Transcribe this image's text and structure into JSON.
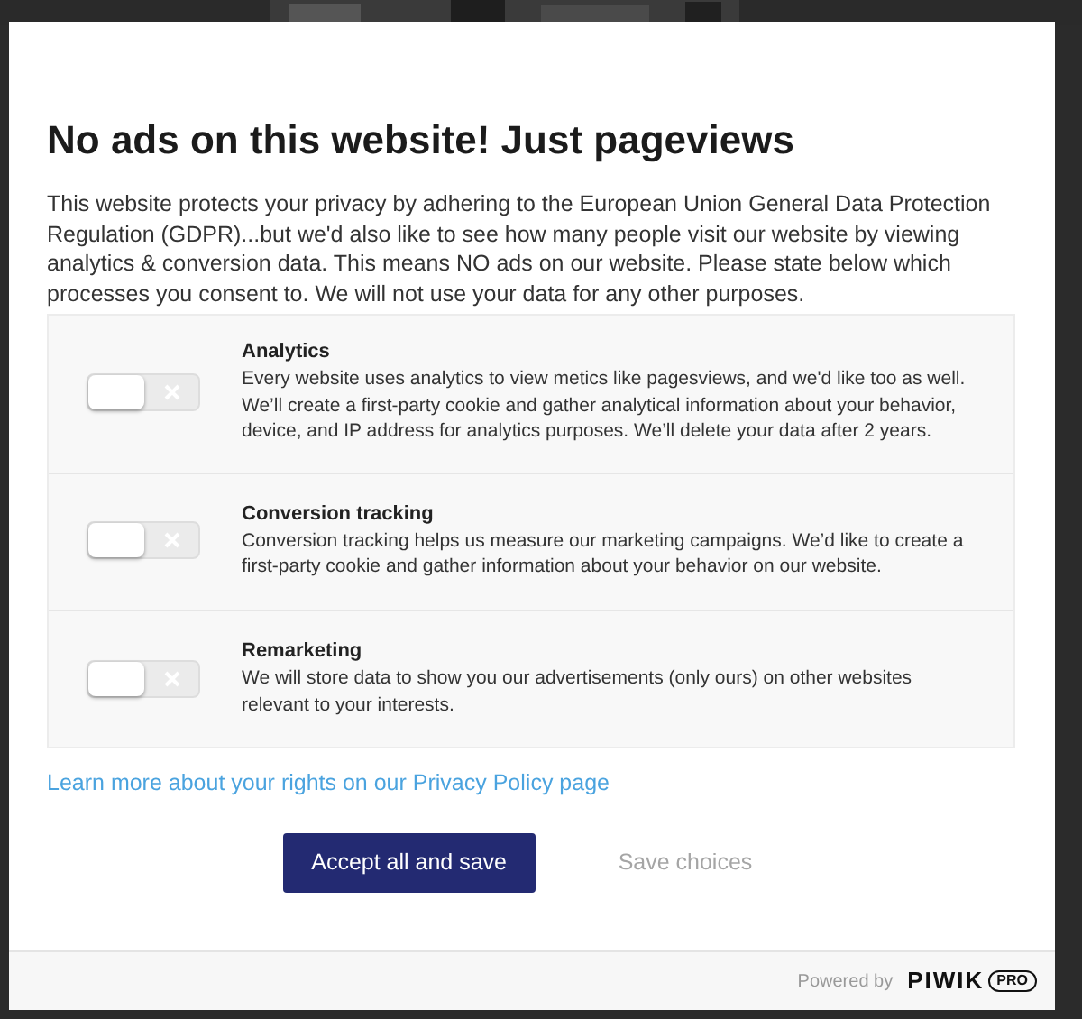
{
  "dialog": {
    "title": "No ads on this website! Just pageviews",
    "intro": "This website protects your privacy by adhering to the European Union General Data Protection Regulation (GDPR)...but we'd also like to see how many people visit our website by viewing analytics & conversion data. This means NO ads on our website. Please state below which processes you consent to. We will not use your data for any other purposes.",
    "consents": [
      {
        "title": "Analytics",
        "description": "Every website uses analytics to view metics like pagesviews, and we'd like too as well. We’ll create a first-party cookie and gather analytical information about your behavior, device, and IP address for analytics purposes. We’ll delete your data after 2 years.",
        "checked": false
      },
      {
        "title": "Conversion tracking",
        "description": "Conversion tracking helps us measure our marketing campaigns. We’d like to create a first-party cookie and gather information about your behavior on our website.",
        "checked": false
      },
      {
        "title": "Remarketing",
        "description": "We will store data to show you our advertisements (only ours) on other websites relevant to your interests.",
        "checked": false
      }
    ],
    "policy_link": "Learn more about your rights on our Privacy Policy page",
    "buttons": [
      {
        "label": "Accept all and save",
        "kind": "primary"
      },
      {
        "label": "Save choices",
        "kind": "secondary"
      }
    ],
    "footer": {
      "powered_by": "Powered by",
      "brand": "PIWIK",
      "brand_badge": "PRO"
    }
  }
}
